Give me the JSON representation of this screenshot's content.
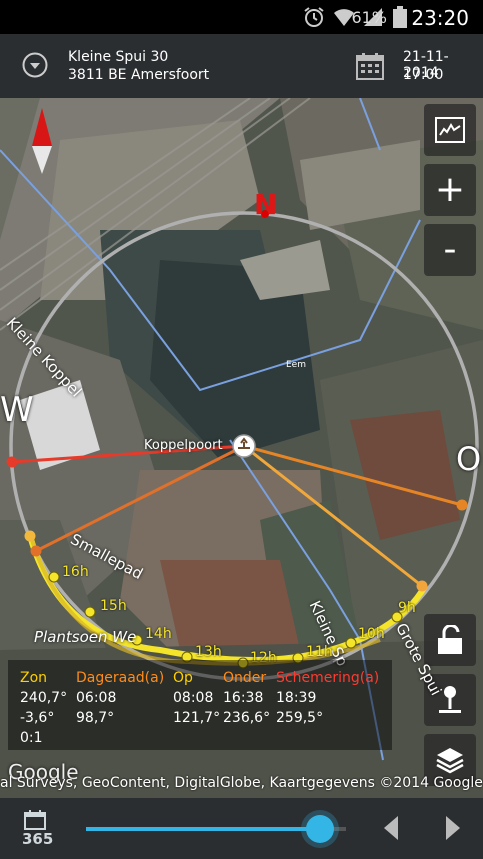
{
  "status_bar": {
    "battery": "61%",
    "time": "23:20",
    "icons": [
      "alarm-icon",
      "wifi-icon",
      "signal-icon",
      "battery-icon"
    ]
  },
  "header": {
    "address_line1": "Kleine Spui 30",
    "address_line2": "3811 BE Amersfoort",
    "date": "21-11-2014",
    "time": "17:00"
  },
  "map": {
    "compass_labels": {
      "north": "N",
      "west": "W",
      "east": "O"
    },
    "center_label": "Koppelpoort",
    "street_labels": [
      "Kleine Koppel",
      "Smallepad",
      "Plantsoen We",
      "Kleine Sp",
      "Grote Spui",
      "Eem"
    ],
    "hour_labels": [
      "16h",
      "15h",
      "14h",
      "13h",
      "12h",
      "11h",
      "10h",
      "9h"
    ],
    "zoom_in": "+",
    "zoom_out": "-",
    "google_logo": "Google",
    "credit": "al Surveys, GeoContent, DigitalGlobe, Kaartgegevens ©2014 Google"
  },
  "info_panel": {
    "headers": [
      "Zon",
      "Dageraad(a)",
      "Op",
      "Onder",
      "Schemering(a)"
    ],
    "header_colors": [
      "#ffd000",
      "#ff8c1a",
      "#ffd000",
      "#ff8c1a",
      "#ff3b30"
    ],
    "row1": [
      "240,7°",
      "06:08",
      "08:08",
      "16:38",
      "18:39"
    ],
    "row2": [
      "-3,6°",
      "98,7°",
      "121,7°",
      "236,6°",
      "259,5°"
    ],
    "row3": [
      "0:1"
    ]
  },
  "bottom_bar": {
    "days": "365",
    "slider_value": 0.9
  },
  "colors": {
    "accent": "#33b5e5",
    "sun_path": "#f4e52b",
    "sunset": "#ff3b30",
    "dusk_line": "#ff8c1a"
  }
}
